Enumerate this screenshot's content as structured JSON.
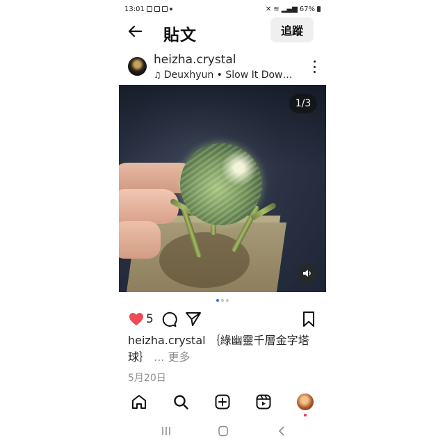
{
  "status_bar": {
    "time": "13:01",
    "battery": "67%"
  },
  "header": {
    "title": "貼文",
    "follow_label": "追蹤"
  },
  "post": {
    "username": "heizha.crystal",
    "music": "Deuxhyun • Slow It Dow…",
    "media_counter": "1/3",
    "carousel_total": 3,
    "carousel_index": 1,
    "like_count": "5",
    "liked": true,
    "caption_user": "heizha.crystal",
    "caption_text": "｛綠幽靈千層金字塔球｝",
    "caption_more": "... 更多",
    "date": "5月20日"
  },
  "colors": {
    "like_red": "#ed4956",
    "carousel_active": "#3b6fe0",
    "notification_dot": "#ff3040",
    "follow_bg": "#efefef"
  },
  "icons": {
    "back": "arrow-left-icon",
    "more": "more-vertical-icon",
    "like": "heart-icon",
    "comment": "comment-icon",
    "share": "send-icon",
    "save": "bookmark-icon",
    "sound": "speaker-icon",
    "home": "home-icon",
    "search": "search-icon",
    "create": "plus-square-icon",
    "reels": "reels-icon",
    "recents": "recents-icon",
    "system_home": "system-home-icon",
    "system_back": "chevron-left-icon"
  }
}
